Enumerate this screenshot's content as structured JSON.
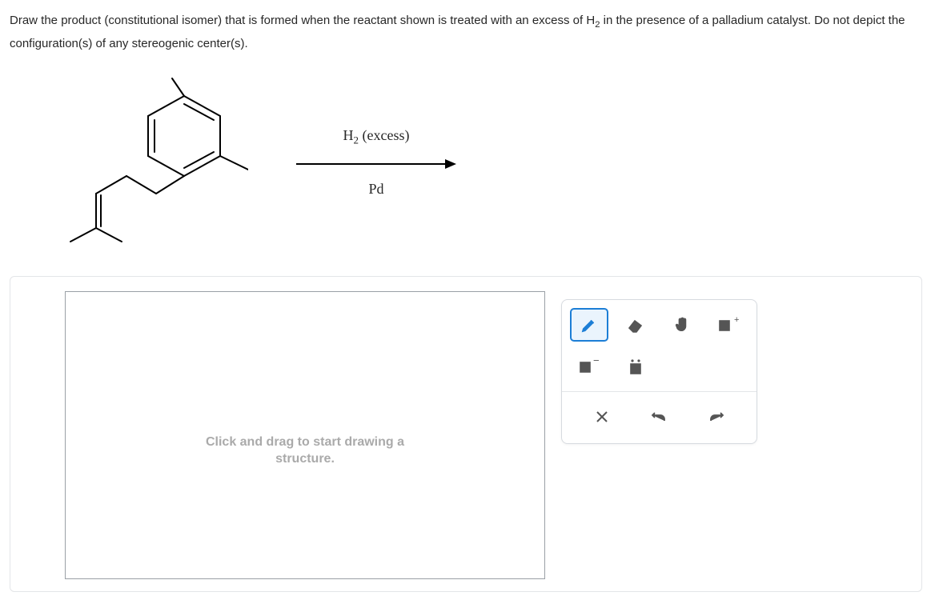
{
  "problem": {
    "text_pre": "Draw the product (constitutional isomer) that is formed when the reactant shown is treated with an excess of H",
    "sub1": "2",
    "text_post": " in the presence of a palladium catalyst. Do not depict the configuration(s) of any stereogenic center(s)."
  },
  "reaction": {
    "reagent_top_pre": "H",
    "reagent_top_sub": "2",
    "reagent_top_post": " (excess)",
    "reagent_bottom": "Pd"
  },
  "canvas": {
    "placeholder_line1": "Click and drag to start drawing a",
    "placeholder_line2": "structure."
  },
  "tools": {
    "draw": "Draw",
    "erase": "Erase",
    "move": "Move",
    "charge_plus": "Positive charge",
    "charge_minus": "Negative charge",
    "lone_pair": "Lone pair",
    "clear": "Clear",
    "undo": "Undo",
    "redo": "Redo"
  }
}
